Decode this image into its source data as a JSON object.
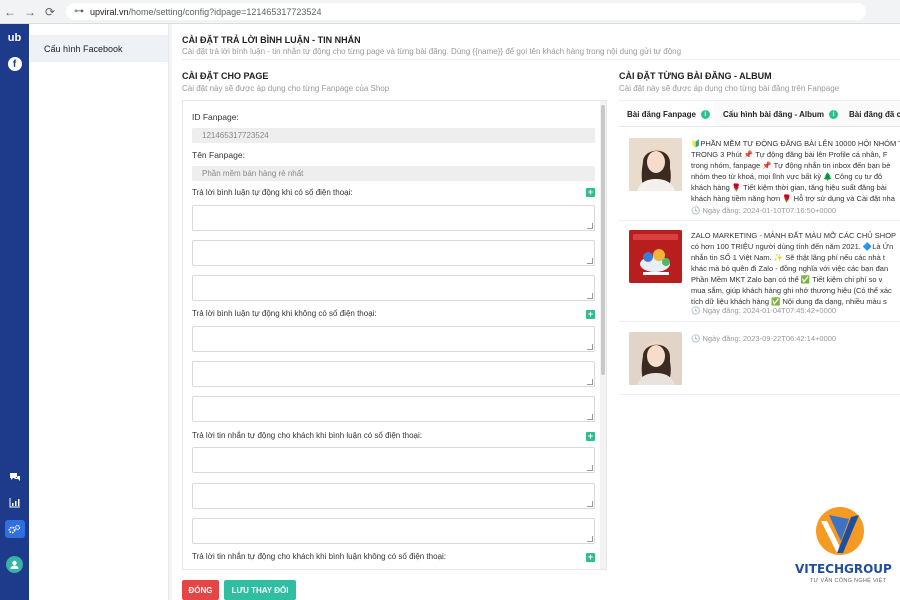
{
  "browser": {
    "url_host": "upviral.vn",
    "url_path": "/home/setting/config?idpage=121465317723524",
    "back": "←",
    "forward": "→",
    "reload": "⟳",
    "tune": "⊶"
  },
  "rail": {
    "logo": "ub",
    "fb": "f",
    "bottom_icons": [
      "chat-icon",
      "chart-icon",
      "settings-icon"
    ]
  },
  "menu": {
    "items": [
      {
        "label": "Cấu hình Facebook"
      }
    ]
  },
  "header": {
    "title": "CÀI ĐẶT TRẢ LỜI BÌNH LUẬN - TIN NHẮN",
    "subtitle": "Cài đặt trả lời bình luận - tin nhắn tự động cho từng page và từng bài đăng. Dùng {{name}} để gọi tên khách hàng trong nội dung gửi tự động"
  },
  "page_section": {
    "title": "CÀI ĐẶT CHO PAGE",
    "subtitle": "Cài đặt này sẽ được áp dụng cho từng Fanpage của Shop"
  },
  "post_section": {
    "title": "CÀI ĐẶT TỪNG BÀI ĐĂNG - ALBUM",
    "subtitle": "Cài đặt này sẽ được áp dụng cho từng bài đăng trên Fanpage"
  },
  "form": {
    "id_label": "ID Fanpage:",
    "id_value": "121465317723524",
    "name_label": "Tên Fanpage:",
    "name_value": "Phần mềm bán hàng rẻ nhất",
    "groups": [
      {
        "label": "Trả lời bình luận tự động khi có số điện thoại:"
      },
      {
        "label": "Trả lời bình luận tự động khi không có số điện thoại:"
      },
      {
        "label": "Trả lời tin nhắn tự động cho khách khi bình luận có số điện thoại:"
      },
      {
        "label": "Trả lời tin nhắn tự động cho khách khi bình luận không có số điện thoại:"
      }
    ],
    "plus": "+"
  },
  "buttons": {
    "close": "ĐÓNG",
    "save": "LƯU THAY ĐỔI"
  },
  "tabs": [
    {
      "label": "Bài đăng Fanpage",
      "info": "i"
    },
    {
      "label": "Cấu hình bài đăng - Album",
      "info": "i"
    },
    {
      "label": "Bài đăng đã c"
    }
  ],
  "posts": [
    {
      "lines": [
        "🔰PHẦN MỀM TỰ ĐỘNG ĐĂNG BÀI LÊN 10000 HỘI NHÓM T",
        "TRONG 3 Phút 📌 Tự động đăng bài lên Profile cá nhân, F",
        "trong nhóm, fanpage 📌 Tự động nhắn tin inbox đến bạn bè",
        "nhóm theo từ khoá, mọi lĩnh vực bất kỳ 🌲 Công cụ tư đô",
        "khách hàng 🌹 Tiết kiệm thời gian, tăng hiệu suất đăng bài",
        "khách hàng tiềm năng hơn 🌹 Hỗ trợ sử dụng và Cài đặt nha"
      ],
      "date": "Ngày đăng: 2024-01-10T07:16:50+0000"
    },
    {
      "lines": [
        "ZALO MARKETING - MẢNH ĐẤT MÀU MỠ CÁC CHỦ SHOP",
        "có hơn 100 TRIỆU người dùng tính đến năm 2021. 🔷Là Ứn",
        "nhắn tin SỐ 1 Việt Nam. ✨ Sẽ thật lãng phí nếu các nhà t",
        "khác mà bỏ quên đi Zalo - đồng nghĩa với việc các bạn đan",
        "Phần Mềm MKT Zalo bạn có thể ✅ Tiết kiệm chi phí so v",
        "mua sắm, giúp khách hàng ghi nhớ thương hiệu (Có thể xác",
        "tích dữ liệu khách hàng ✅ Nội dung đa dạng, nhiều màu s"
      ],
      "date": "Ngày đăng: 2024-01-04T07:45:42+0000"
    },
    {
      "lines": [],
      "date": "Ngày đăng: 2023-09-22T06:42:14+0000"
    }
  ],
  "brand": {
    "name": "VITECHGROUP",
    "tagline": "TƯ VẤN CÔNG NGHỆ VIỆT"
  }
}
